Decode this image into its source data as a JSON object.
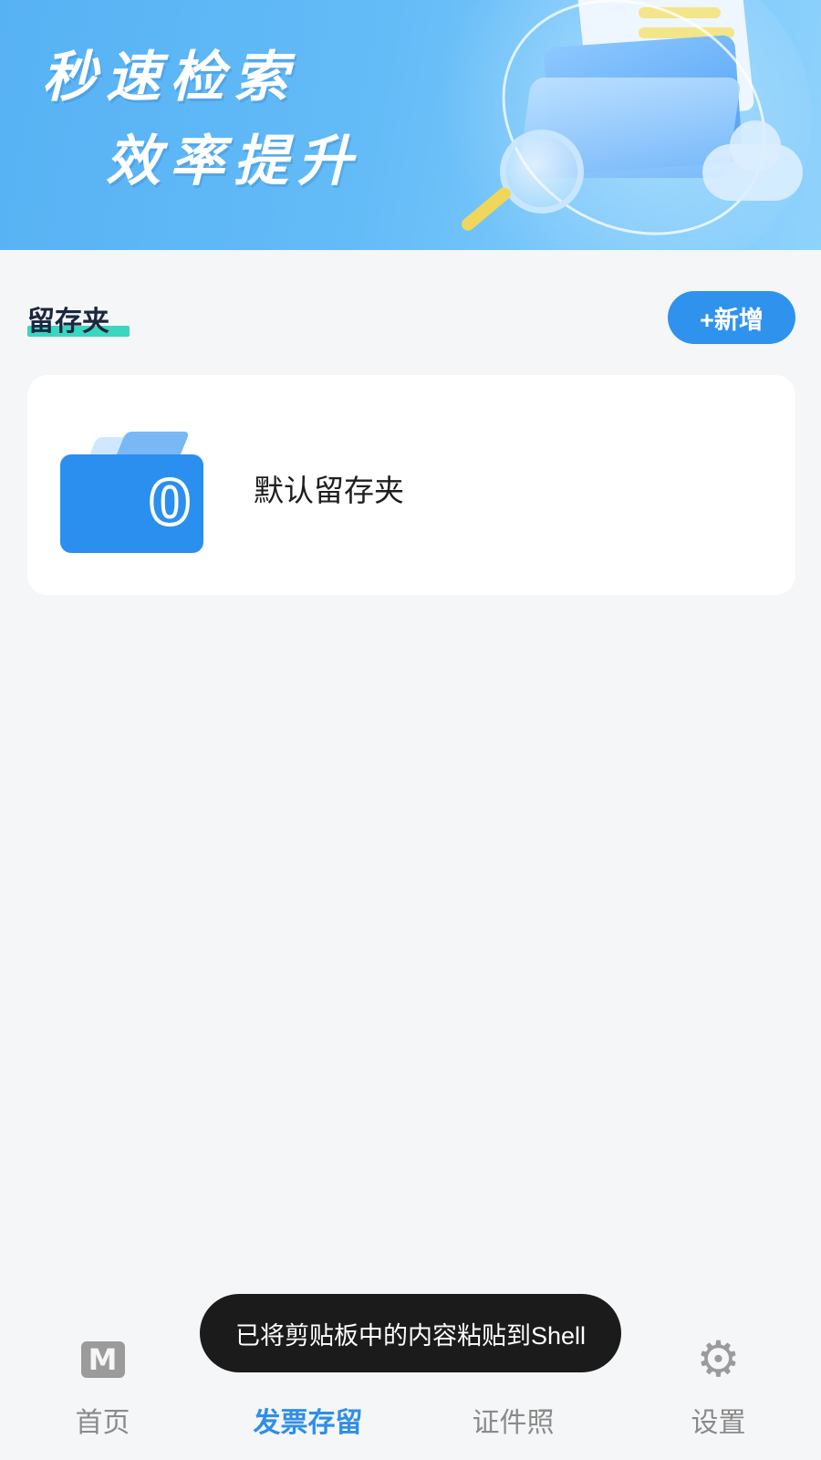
{
  "banner": {
    "line1": "秒速检索",
    "line2": "效率提升"
  },
  "section": {
    "title": "留存夹",
    "add_label": "+新增"
  },
  "folders": [
    {
      "name": "默认留存夹",
      "count": "0"
    }
  ],
  "nav": {
    "items": [
      {
        "label": "首页",
        "icon": "home-m-icon",
        "active": false
      },
      {
        "label": "发票存留",
        "icon": "invoice-icon",
        "active": true
      },
      {
        "label": "证件照",
        "icon": "id-photo-icon",
        "active": false
      },
      {
        "label": "设置",
        "icon": "gear-icon",
        "active": false
      }
    ]
  },
  "toast": {
    "text": "已将剪贴板中的内容粘贴到Shell"
  },
  "colors": {
    "accent": "#2f8fe6",
    "banner_start": "#57b2f4",
    "banner_end": "#8fd2fc",
    "highlight": "#3ad6c0",
    "toast_bg": "#1b1b1b",
    "page_bg": "#f5f6f8"
  }
}
